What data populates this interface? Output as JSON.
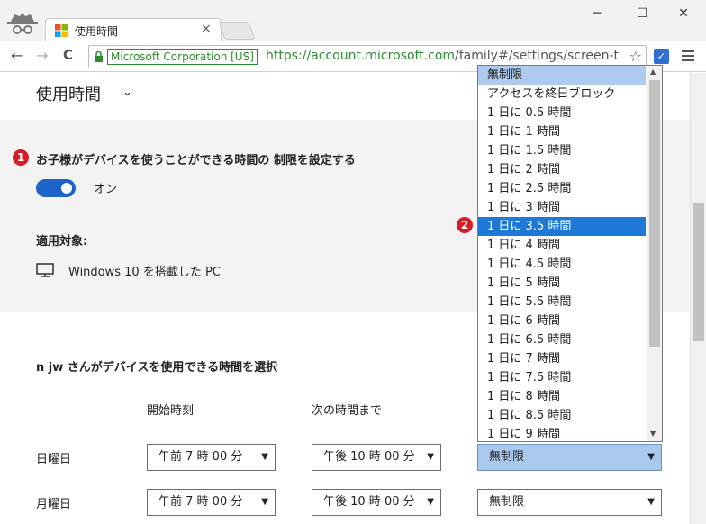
{
  "browser": {
    "tab_title": "使用時間",
    "close_glyph": "×",
    "window_controls": [
      "─",
      "☐",
      "✕"
    ],
    "nav": {
      "back": "←",
      "forward": "→",
      "reload": "C"
    },
    "ev_label": "Microsoft Corporation [US]",
    "url_scheme_host": "https://account.microsoft.com",
    "url_path": "/family#/settings/screen-t",
    "star_glyph": "☆",
    "extension_glyph": "✓"
  },
  "page": {
    "title": "使用時間",
    "title_chevron": "⌄",
    "setting_heading": "お子様がデバイスを使うことができる時間の 制限を設定する",
    "toggle_state_label": "オン",
    "applies_label": "適用対象:",
    "device_name": "Windows 10 を搭載した PC",
    "choose_heading": "n jw さんがデバイスを使用できる時間を選択",
    "column_headers": [
      "開始時刻",
      "次の時間まで"
    ],
    "days": [
      {
        "label": "日曜日",
        "start": "午前 7 時 00 分",
        "end": "午後 10 時 00 分",
        "limit": "無制限"
      },
      {
        "label": "月曜日",
        "start": "午前 7 時 00 分",
        "end": "午後 10 時 00 分",
        "limit": "無制限"
      }
    ],
    "select_arrow": "▼"
  },
  "callouts": {
    "one": "1",
    "two": "2"
  },
  "dropdown": {
    "options": [
      "無制限",
      "アクセスを終日ブロック",
      "1 日に 0.5 時間",
      "1 日に 1 時間",
      "1 日に 1.5 時間",
      "1 日に 2 時間",
      "1 日に 2.5 時間",
      "1 日に 3 時間",
      "1 日に 3.5 時間",
      "1 日に 4 時間",
      "1 日に 4.5 時間",
      "1 日に 5 時間",
      "1 日に 5.5 時間",
      "1 日に 6 時間",
      "1 日に 6.5 時間",
      "1 日に 7 時間",
      "1 日に 7.5 時間",
      "1 日に 8 時間",
      "1 日に 8.5 時間",
      "1 日に 9 時間"
    ],
    "selected_option": "1 日に 3.5 時間",
    "scroll_up": "▲",
    "scroll_down": "▼"
  },
  "colors": {
    "accent": "#1e64c8",
    "selected": "#1e78d7",
    "badge": "#d61c24",
    "ev_green": "#2e8a2e"
  }
}
